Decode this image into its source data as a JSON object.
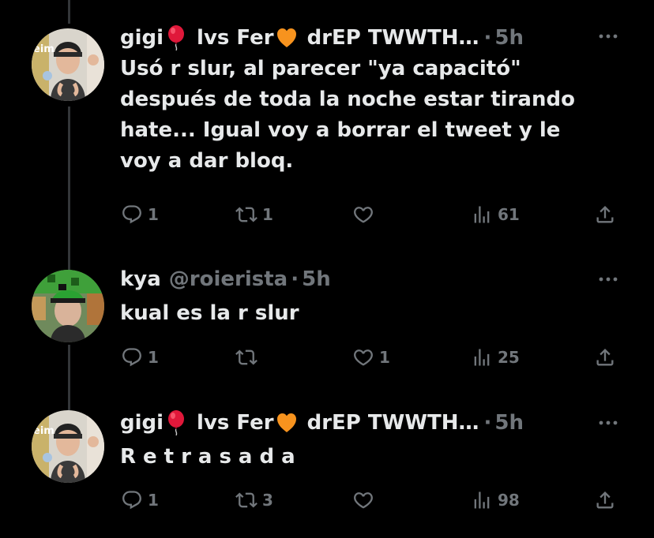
{
  "tweets": [
    {
      "name_part1": "gigi",
      "name_part2": "lvs Fer",
      "name_part3": "drEP TWWTH…",
      "handle": "",
      "separator": "·",
      "time": "5h",
      "body_lines": [
        "Usó r slur, al parecer \"ya capacitó\"",
        "después de toda la noche estar tirando",
        "hate... Igual voy a borrar el tweet y le",
        "voy a dar bloq."
      ],
      "replies": "1",
      "retweets": "1",
      "likes": "",
      "views": "61"
    },
    {
      "name_part1": "kya",
      "handle": "@roierista",
      "separator": "·",
      "time": "5h",
      "body_lines": [
        "kual es la r slur"
      ],
      "replies": "1",
      "retweets": "",
      "likes": "1",
      "views": "25"
    },
    {
      "name_part1": "gigi",
      "name_part2": "lvs Fer",
      "name_part3": "drEP TWWTH…",
      "separator": "·",
      "time": "5h",
      "body_lines": [
        "Retrasada"
      ],
      "replies": "1",
      "retweets": "3",
      "likes": "",
      "views": "98"
    }
  ],
  "icons": {
    "balloon": "red-balloon-emoji",
    "heart": "orange-heart-emoji",
    "reply": "reply-icon",
    "retweet": "retweet-icon",
    "like": "heart-icon",
    "views": "views-icon",
    "share": "share-icon",
    "more": "more-icon"
  },
  "colors": {
    "background": "#000000",
    "text": "#e7e9ea",
    "muted": "#71767b",
    "balloon": "#e0183a",
    "orange_heart": "#f7931e"
  }
}
